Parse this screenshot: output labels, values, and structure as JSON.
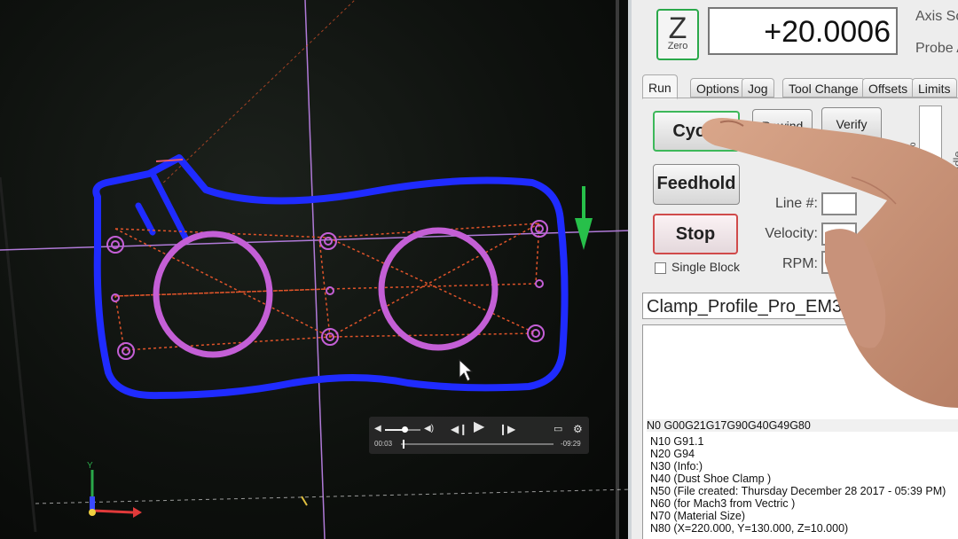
{
  "panel": {
    "z_button": {
      "letter": "Z",
      "sub": "Zero"
    },
    "z_dro": "+20.0006",
    "axis_label_1": "Axis Sc",
    "axis_label_2": "Probe A",
    "tabs": [
      "Run",
      "Options",
      "Jog",
      "Tool Change",
      "Offsets",
      "Limits"
    ],
    "active_tab": "Run",
    "buttons": {
      "cycle_start": "Cycle",
      "rewind": "Rewind",
      "verify": "Verify",
      "feedhold": "Feedhold",
      "stop": "Stop"
    },
    "fields": {
      "line": "Line #:",
      "velocity": "Velocity:",
      "rpm": "RPM:"
    },
    "single_block": "Single Block",
    "side_labels": {
      "rate": "ate",
      "override": "ide %",
      "spindle": "ndle"
    },
    "file_name": "Clamp_Profile_Pro_EM3m",
    "gcode_lines": [
      "N0 G00G21G17G90G40G49G80",
      "N10 G91.1",
      "N20 G94",
      "N30 (Info:)",
      "N40 (Dust  Shoe  Clamp )",
      "N50 (File created: Thursday December 28 2017 - 05:39 PM)",
      "N60 (for Mach3 from Vectric )",
      "N70 (Material Size)",
      "N80 (X=220.000, Y=130.000, Z=10.000)"
    ]
  },
  "video": {
    "elapsed": "00:03",
    "remaining": "-09:29",
    "progress": 0.01,
    "volume": 0.55
  },
  "icons": {
    "volume_low": "volume-low-icon",
    "volume_high": "volume-high-icon",
    "prev": "skip-back-icon",
    "play": "play-icon",
    "next": "skip-forward-icon",
    "airplay": "airplay-icon",
    "settings": "gear-icon",
    "cursor": "mouse-cursor-icon",
    "axis_triad": "axis-triad-icon",
    "tool_marker": "tool-position-arrow-icon"
  },
  "colors": {
    "profile": "#1f2bff",
    "pocket": "#c45fd6",
    "rapid": "#e0542a",
    "crosshair": "#b07ad8",
    "tool_arrow": "#27c04a",
    "z_button_border": "#2aa84a"
  }
}
